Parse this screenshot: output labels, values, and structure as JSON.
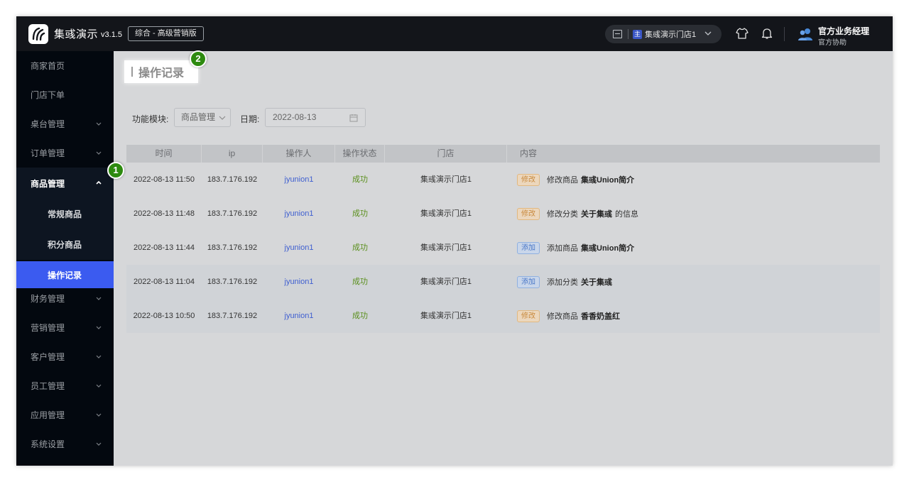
{
  "app": {
    "brand": "集彧演示",
    "version": "v3.1.5",
    "edition": "综合 - 高级营销版"
  },
  "topbar": {
    "store_badge": "主",
    "store_name": "集彧演示门店1",
    "user_name": "官方业务经理",
    "user_role": "官方协助"
  },
  "sidebar": {
    "items": [
      {
        "label": "商家首页"
      },
      {
        "label": "门店下单"
      },
      {
        "label": "桌台管理"
      },
      {
        "label": "订单管理"
      },
      {
        "label": "商品管理"
      },
      {
        "label": "财务管理"
      },
      {
        "label": "营销管理"
      },
      {
        "label": "客户管理"
      },
      {
        "label": "员工管理"
      },
      {
        "label": "应用管理"
      },
      {
        "label": "系统设置"
      }
    ],
    "sub_items": [
      {
        "label": "常规商品"
      },
      {
        "label": "积分商品"
      },
      {
        "label": "操作记录"
      }
    ]
  },
  "page": {
    "title": "操作记录",
    "step_1": "1",
    "step_2": "2"
  },
  "filters": {
    "module_label": "功能模块:",
    "module_value": "商品管理",
    "date_label": "日期:",
    "date_value": "2022-08-13"
  },
  "table": {
    "headers": [
      "时间",
      "ip",
      "操作人",
      "操作状态",
      "门店",
      "内容"
    ],
    "rows": [
      {
        "time": "2022-08-13 11:50",
        "ip": "183.7.176.192",
        "user": "jyunion1",
        "status": "成功",
        "store": "集彧演示门店1",
        "tag": "修改",
        "action": "修改商品",
        "target": "集彧Union简介",
        "suffix": ""
      },
      {
        "time": "2022-08-13 11:48",
        "ip": "183.7.176.192",
        "user": "jyunion1",
        "status": "成功",
        "store": "集彧演示门店1",
        "tag": "修改",
        "action": "修改分类",
        "target": "关于集彧",
        "suffix": "的信息"
      },
      {
        "time": "2022-08-13 11:44",
        "ip": "183.7.176.192",
        "user": "jyunion1",
        "status": "成功",
        "store": "集彧演示门店1",
        "tag": "添加",
        "action": "添加商品",
        "target": "集彧Union简介",
        "suffix": ""
      },
      {
        "time": "2022-08-13 11:04",
        "ip": "183.7.176.192",
        "user": "jyunion1",
        "status": "成功",
        "store": "集彧演示门店1",
        "tag": "添加",
        "action": "添加分类",
        "target": "关于集彧",
        "suffix": ""
      },
      {
        "time": "2022-08-13 10:50",
        "ip": "183.7.176.192",
        "user": "jyunion1",
        "status": "成功",
        "store": "集彧演示门店1",
        "tag": "修改",
        "action": "修改商品",
        "target": "香香奶盖红",
        "suffix": ""
      }
    ]
  }
}
